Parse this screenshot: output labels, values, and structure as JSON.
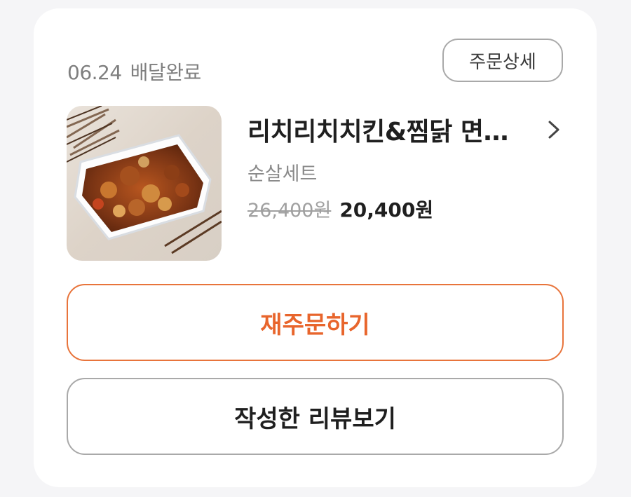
{
  "order": {
    "date": "06.24",
    "status": "배달완료",
    "detail_button": "주문상세"
  },
  "item": {
    "store_name": "리치리치치킨&찜닭 면…",
    "option": "순살세트",
    "original_price": "26,400원",
    "price": "20,400원",
    "image_icon": "food-photo"
  },
  "actions": {
    "reorder_label": "재주문하기",
    "review_label": "작성한 리뷰보기"
  },
  "colors": {
    "accent": "#e8652c",
    "border_gray": "#a9a9a9",
    "text_dark": "#1f1f1f",
    "text_muted": "#7f7f7f"
  }
}
